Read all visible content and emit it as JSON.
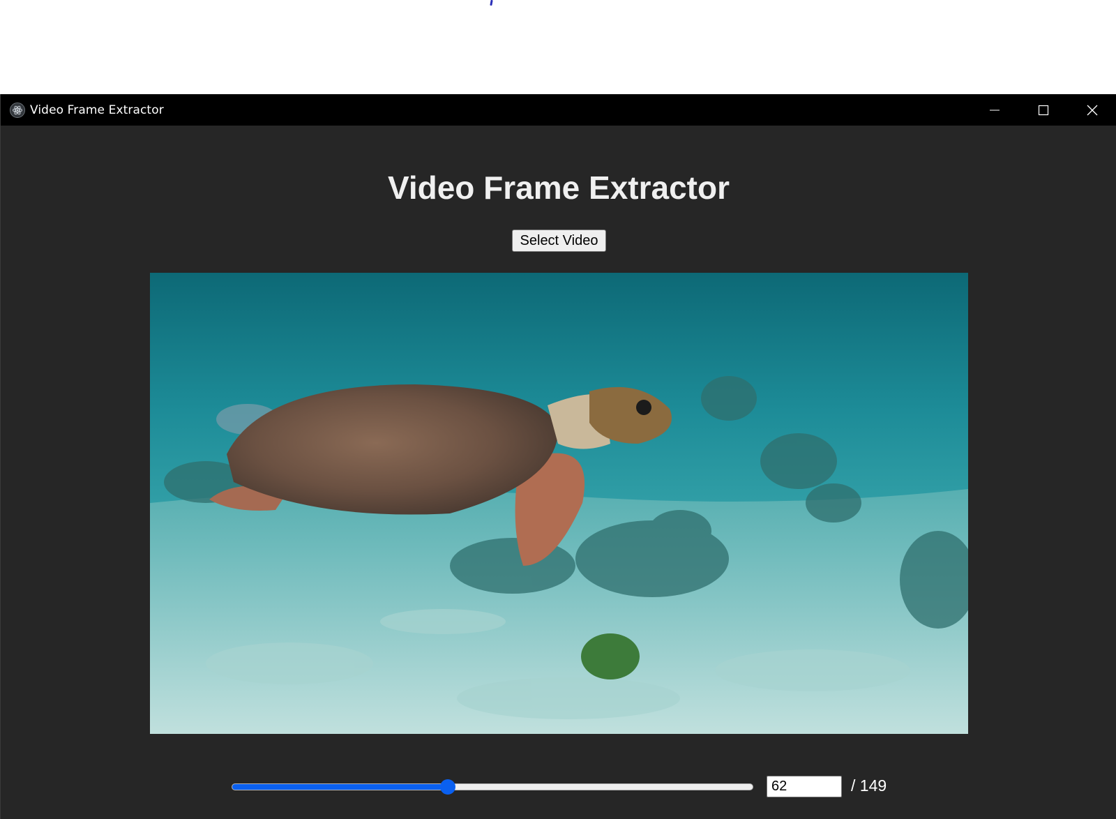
{
  "window": {
    "title": "Video Frame Extractor",
    "app_icon": "electron-icon",
    "controls": [
      "minimize-icon",
      "maximize-icon",
      "close-icon"
    ]
  },
  "main": {
    "heading": "Video Frame Extractor",
    "select_button_label": "Select Video",
    "video_frame": {
      "description_icon": "video-frame-image"
    },
    "frame_controls": {
      "current_frame": "62",
      "total_label": "/ 149",
      "slider_fraction": 0.414
    }
  },
  "colors": {
    "window_bg": "#262626",
    "titlebar_bg": "#000000",
    "accent": "#0a60f0"
  }
}
